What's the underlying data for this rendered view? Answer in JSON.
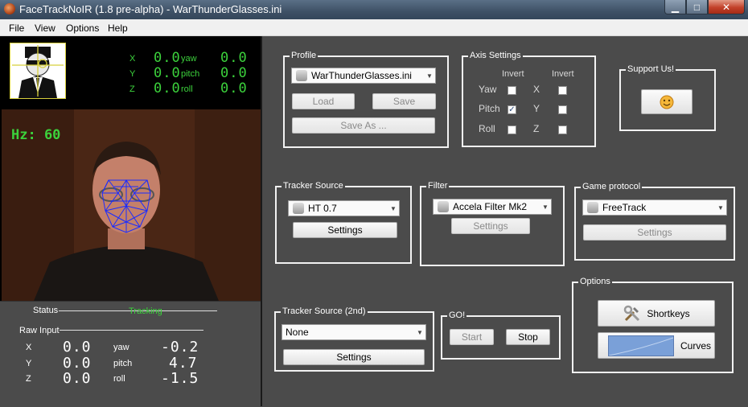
{
  "window": {
    "title": "FaceTrackNoIR (1.8 pre-alpha) - WarThunderGlasses.ini",
    "minimize_glyph": "▁",
    "maximize_glyph": "□",
    "close_glyph": "✕"
  },
  "menu": [
    "File",
    "View",
    "Options",
    "Help"
  ],
  "pose_display": {
    "rows": [
      {
        "axis": "X",
        "value": "0.0",
        "rot": "yaw",
        "rot_value": "0.0"
      },
      {
        "axis": "Y",
        "value": "0.0",
        "rot": "pitch",
        "rot_value": "0.0"
      },
      {
        "axis": "Z",
        "value": "0.0",
        "rot": "roll",
        "rot_value": "0.0"
      }
    ]
  },
  "camera": {
    "hz_label": "Hz: 60"
  },
  "status": {
    "status_label": "Status",
    "status_value": "Tracking",
    "raw_input_label": "Raw Input",
    "rows": [
      {
        "axis": "X",
        "value": "0.0",
        "rot": "yaw",
        "rot_value": "-0.2"
      },
      {
        "axis": "Y",
        "value": "0.0",
        "rot": "pitch",
        "rot_value": "4.7"
      },
      {
        "axis": "Z",
        "value": "0.0",
        "rot": "roll",
        "rot_value": "-1.5"
      }
    ]
  },
  "profile": {
    "label": "Profile",
    "selected": "WarThunderGlasses.ini",
    "load": "Load",
    "save": "Save",
    "save_as": "Save As ..."
  },
  "axis_settings": {
    "label": "Axis Settings",
    "invert_header": "Invert",
    "rot_rows": [
      {
        "name": "Yaw",
        "checked": false
      },
      {
        "name": "Pitch",
        "checked": true
      },
      {
        "name": "Roll",
        "checked": false
      }
    ],
    "trans_rows": [
      {
        "name": "X",
        "checked": false
      },
      {
        "name": "Y",
        "checked": false
      },
      {
        "name": "Z",
        "checked": false
      }
    ],
    "check_glyph": "✓"
  },
  "support": {
    "label": "Support Us!",
    "icon": "smiley-icon"
  },
  "tracker_source": {
    "label": "Tracker Source",
    "selected": "HT 0.7",
    "settings": "Settings"
  },
  "filter": {
    "label": "Filter",
    "selected": "Accela Filter Mk2",
    "settings": "Settings"
  },
  "game_protocol": {
    "label": "Game protocol",
    "selected": "FreeTrack",
    "settings": "Settings"
  },
  "tracker_source_2nd": {
    "label": "Tracker Source (2nd)",
    "selected": "None",
    "settings": "Settings"
  },
  "go": {
    "label": "GO!",
    "start": "Start",
    "stop": "Stop"
  },
  "options": {
    "label": "Options",
    "shortkeys": "Shortkeys",
    "curves": "Curves"
  },
  "colors": {
    "background": "#4b4b4b",
    "display_green": "#3cd23c",
    "title_bar": "#3e5166"
  }
}
